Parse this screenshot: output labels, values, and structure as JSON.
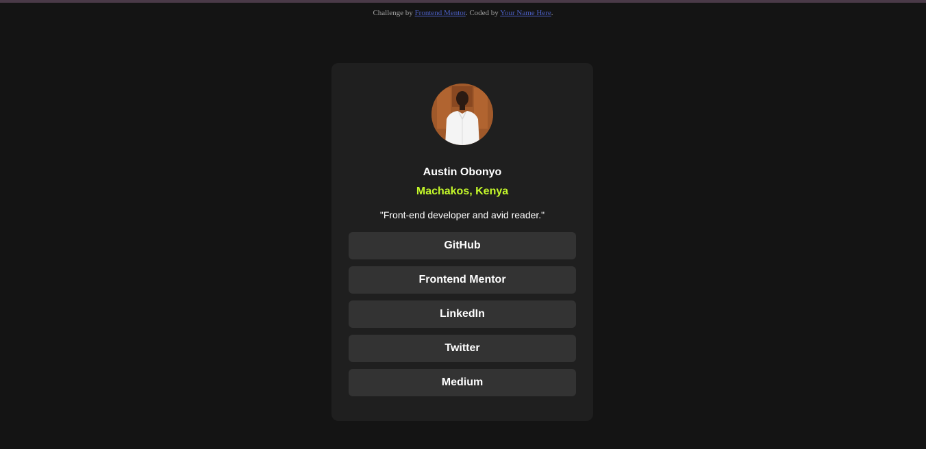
{
  "attribution": {
    "prefix": "Challenge by ",
    "challenge_link": "Frontend Mentor",
    "middle": ". Coded by ",
    "author_link": "Your Name Here",
    "suffix": "."
  },
  "profile": {
    "name": "Austin Obonyo",
    "location": "Machakos, Kenya",
    "bio": "\"Front-end developer and avid reader.\"",
    "avatar_icon": "profile-photo"
  },
  "links": [
    {
      "label": "GitHub"
    },
    {
      "label": "Frontend Mentor"
    },
    {
      "label": "LinkedIn"
    },
    {
      "label": "Twitter"
    },
    {
      "label": "Medium"
    }
  ],
  "colors": {
    "page_background": "#141414",
    "card_background": "#1f1f1f",
    "button_background": "#333333",
    "accent_green": "#c4f82a",
    "link_blue": "#4b5fc4"
  }
}
